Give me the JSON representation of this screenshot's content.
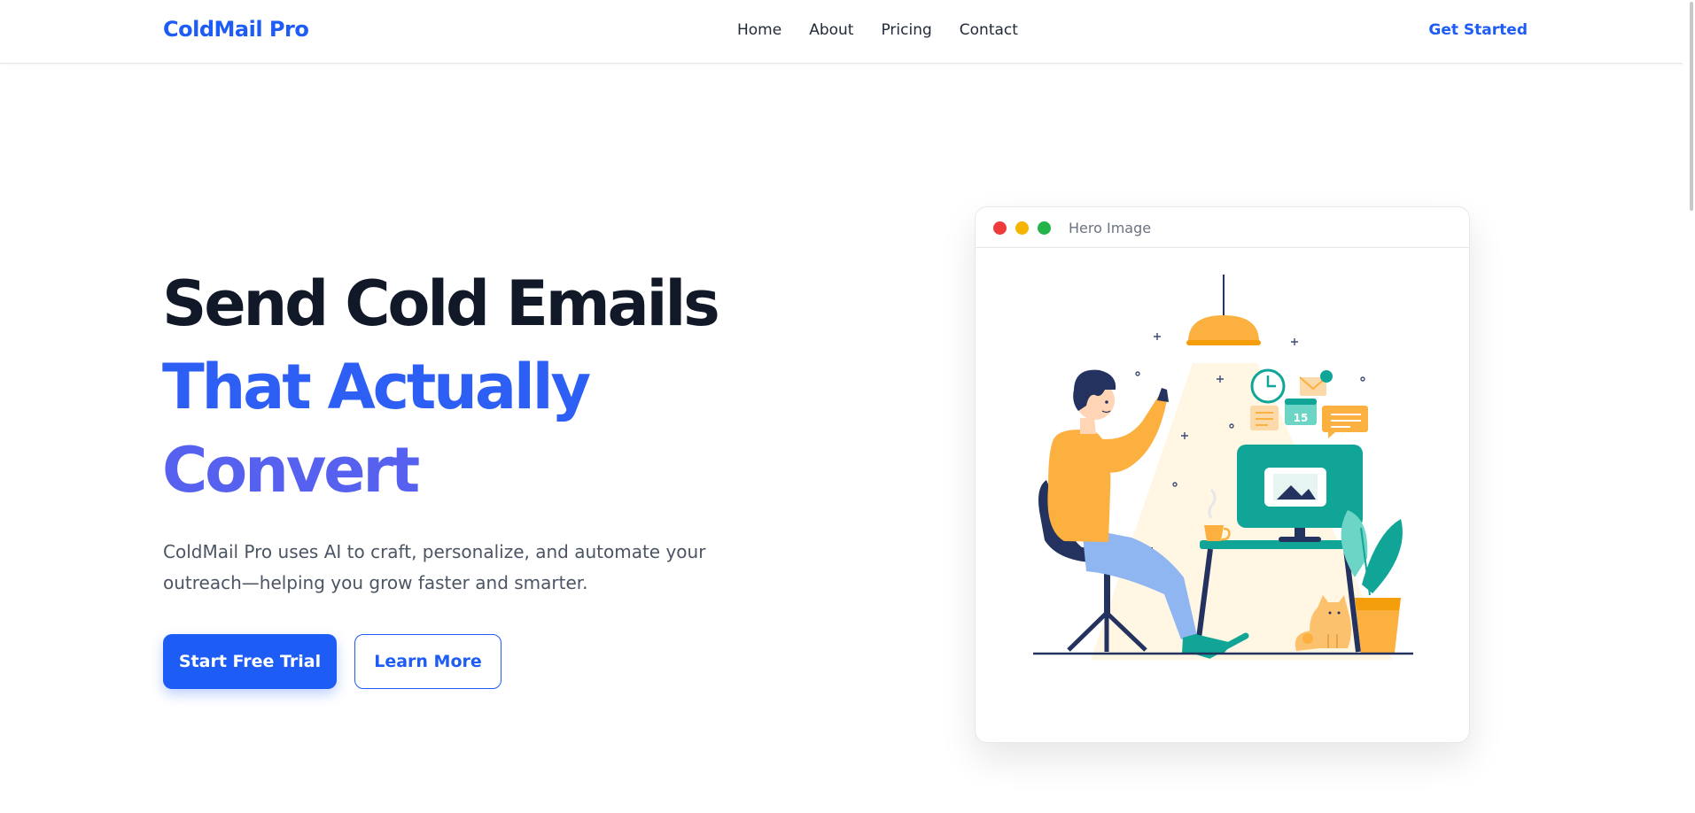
{
  "nav": {
    "brand": "ColdMail Pro",
    "links": [
      {
        "label": "Home"
      },
      {
        "label": "About"
      },
      {
        "label": "Pricing"
      },
      {
        "label": "Contact"
      }
    ],
    "cta_label": "Get Started"
  },
  "hero": {
    "title_line1": "Send Cold Emails",
    "title_line2": "That Actually",
    "title_line3": "Convert",
    "subtitle": "ColdMail Pro uses AI to craft, personalize, and automate your outreach—helping you grow faster and smarter.",
    "primary_button": "Start Free Trial",
    "secondary_button": "Learn More"
  },
  "hero_image": {
    "window_title": "Hero Image",
    "calendar_day": "15",
    "icon": "person-at-desk-illustration"
  },
  "colors": {
    "brand_blue": "#1d5cf5",
    "title_dark": "#111827",
    "title_blue": "#2e5ff5",
    "title_indigo": "#5661f0",
    "illustration_orange": "#fbb040",
    "illustration_teal": "#10a597",
    "illustration_navy": "#23325e"
  }
}
